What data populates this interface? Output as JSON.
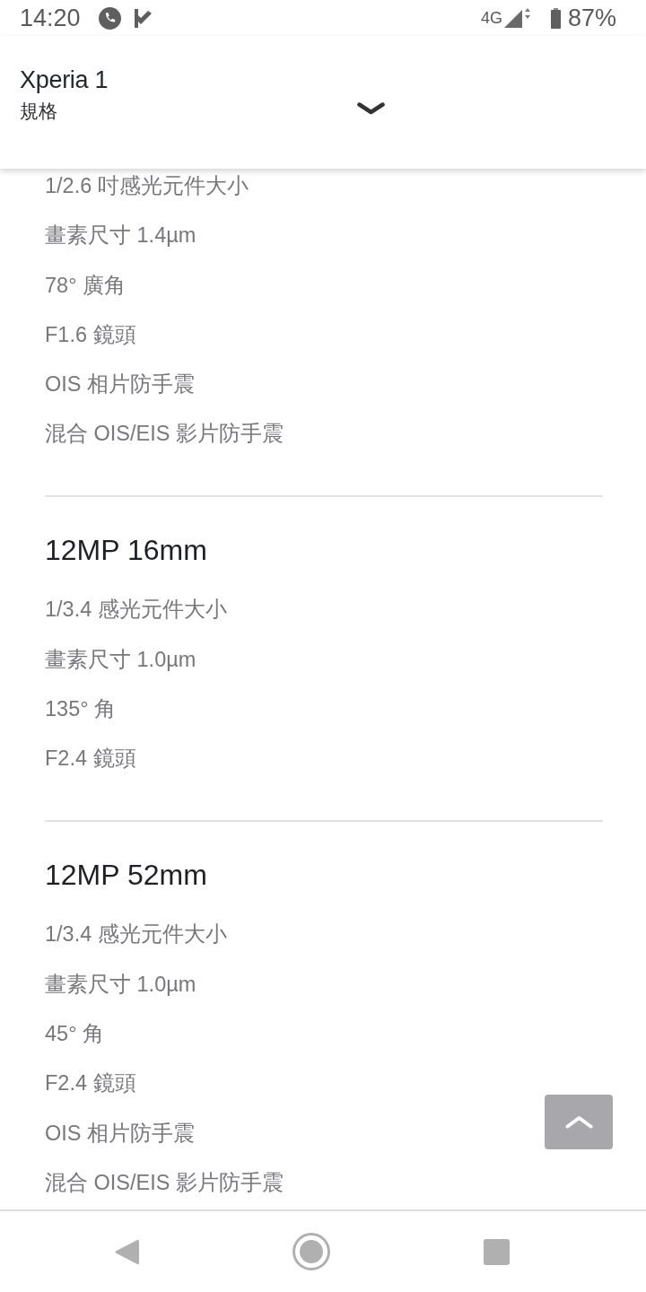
{
  "status_bar": {
    "time": "14:20",
    "network": "4G",
    "battery": "87%"
  },
  "header": {
    "title": "Xperia 1",
    "subtitle": "規格"
  },
  "sections": [
    {
      "items": [
        "1/2.6 吋感光元件大小",
        "畫素尺寸 1.4µm",
        "78° 廣角",
        "F1.6 鏡頭",
        "OIS 相片防手震",
        "混合 OIS/EIS 影片防手震"
      ]
    },
    {
      "heading": "12MP 16mm",
      "items": [
        "1/3.4 感光元件大小",
        "畫素尺寸 1.0µm",
        "135° 角",
        "F2.4 鏡頭"
      ]
    },
    {
      "heading": "12MP 52mm",
      "items": [
        "1/3.4 感光元件大小",
        "畫素尺寸 1.0µm",
        "45° 角",
        "F2.4 鏡頭",
        "OIS 相片防手震",
        "混合 OIS/EIS 影片防手震"
      ]
    }
  ]
}
